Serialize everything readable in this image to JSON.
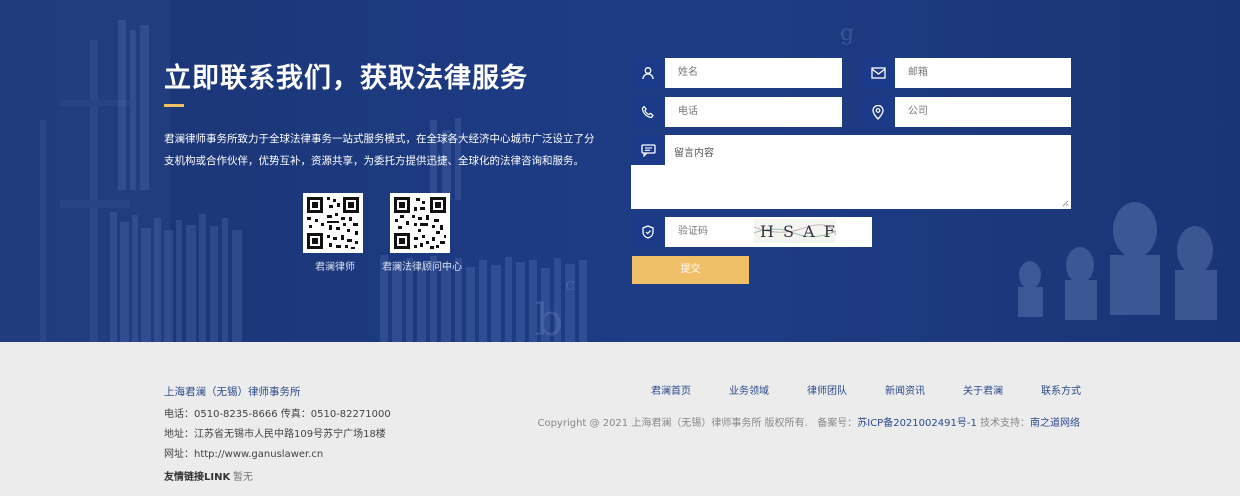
{
  "hero": {
    "title": "立即联系我们，获取法律服务",
    "description": "君澜律师事务所致力于全球法律事务一站式服务模式，在全球各大经济中心城市广泛设立了分支机构或合作伙伴，优势互补，资源共享，为委托方提供迅捷、全球化的法律咨询和服务。",
    "qr_codes": [
      {
        "label": "君澜律师"
      },
      {
        "label": "君澜法律顾问中心"
      }
    ]
  },
  "form": {
    "name_placeholder": "姓名",
    "email_placeholder": "邮箱",
    "phone_placeholder": "电话",
    "company_placeholder": "公司",
    "message_placeholder": "留言内容",
    "captcha_placeholder": "验证码",
    "captcha_text": "H S A F",
    "submit_label": "提交",
    "icons": [
      "user-icon",
      "mail-icon",
      "phone-icon",
      "location-icon",
      "message-icon",
      "shield-icon"
    ]
  },
  "footer": {
    "firm_name": "上海君澜（无锡）律师事务所",
    "phone_line": "电话：0510-8235-8666    传真：0510-82271000",
    "address_line": "地址：江苏省无锡市人民中路109号苏宁广场18楼",
    "website_line": "网址：http://www.ganuslawer.cn",
    "links_title": "友情链接LINK",
    "links_none": "暂无",
    "nav": [
      "君澜首页",
      "业务领域",
      "律师团队",
      "新闻资讯",
      "关于君澜",
      "联系方式"
    ],
    "copyright": "Copyright @ 2021 上海君澜（无锡）律师事务所 版权所有.",
    "icp_label": "备案号：",
    "icp_number": "苏ICP备2021002491号-1",
    "support_label": "技术支持：",
    "support_name": "南之道网络"
  },
  "colors": {
    "hero_bg": "#1d3b82",
    "icon_bg": "#1b3a8a",
    "accent": "#f0c068",
    "link": "#2b4a8c"
  }
}
